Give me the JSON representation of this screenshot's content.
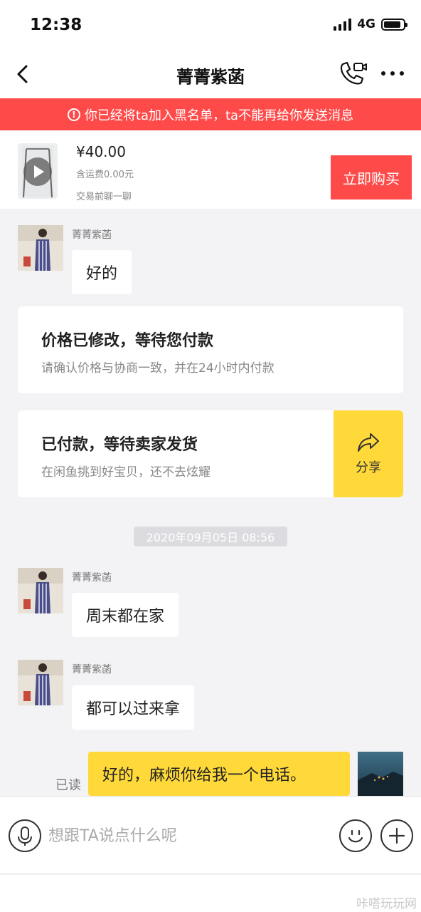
{
  "status_bar": {
    "time": "12:38",
    "network": "4G",
    "battery_level": 0.9
  },
  "header": {
    "title": "菁菁紫菡"
  },
  "banner": {
    "text": "你已经将ta加入黑名单，ta不能再给你发送消息"
  },
  "product": {
    "price": "¥40.00",
    "shipping": "含运费0.00元",
    "hint": "交易前聊一聊",
    "buy_label": "立即购买"
  },
  "messages": {
    "m1": {
      "sender": "菁菁紫菡",
      "text": "好的"
    },
    "card_price": {
      "title": "价格已修改，等待您付款",
      "subtitle": "请确认价格与协商一致，并在24小时内付款"
    },
    "card_paid": {
      "title": "已付款，等待卖家发货",
      "subtitle": "在闲鱼挑到好宝贝，还不去炫耀",
      "share_label": "分享"
    },
    "timestamp": "2020年09月05日 08:56",
    "m2": {
      "sender": "菁菁紫菡",
      "text": "周末都在家"
    },
    "m3": {
      "sender": "菁菁紫菡",
      "text": "都可以过来拿"
    },
    "mine": {
      "read_status": "已读",
      "text": "好的，麻烦你给我一个电话。"
    }
  },
  "input": {
    "placeholder": "想跟TA说点什么呢"
  },
  "watermark": "咔嗒玩玩网",
  "colors": {
    "accent_red": "#ff4a4a",
    "accent_yellow": "#ffd93a",
    "background": "#f3f3f5"
  }
}
